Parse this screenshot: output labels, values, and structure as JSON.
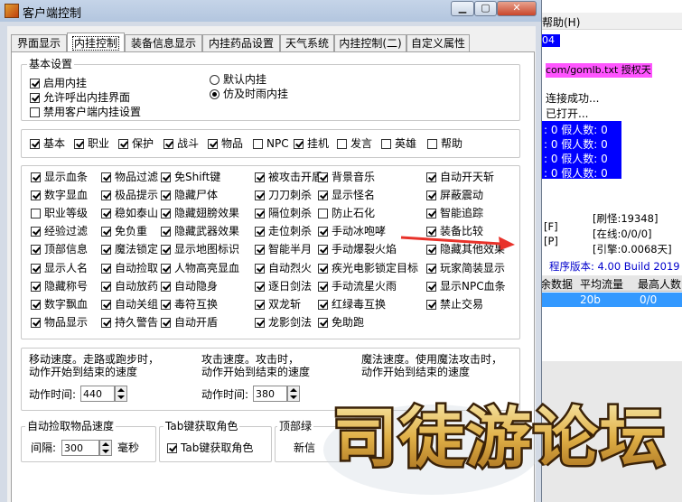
{
  "dialog": {
    "title": "客户端控制",
    "tabs": [
      {
        "label": "界面显示",
        "active": false
      },
      {
        "label": "内挂控制",
        "active": true
      },
      {
        "label": "装备信息显示",
        "active": false
      },
      {
        "label": "内挂药品设置",
        "active": false
      },
      {
        "label": "天气系统",
        "active": false
      },
      {
        "label": "内挂控制(二)",
        "active": false
      },
      {
        "label": "自定义属性",
        "active": false
      }
    ],
    "basic": {
      "title": "基本设置",
      "items": [
        {
          "label": "启用内挂",
          "checked": true
        },
        {
          "label": "允许呼出内挂界面",
          "checked": true
        },
        {
          "label": "禁用客户端内挂设置",
          "checked": false
        }
      ],
      "radios": [
        {
          "label": "默认内挂",
          "selected": false
        },
        {
          "label": "仿及时雨内挂",
          "selected": true
        }
      ]
    },
    "chat_filters": [
      {
        "label": "基本",
        "checked": true
      },
      {
        "label": "职业",
        "checked": true
      },
      {
        "label": "保护",
        "checked": true
      },
      {
        "label": "战斗",
        "checked": true
      },
      {
        "label": "物品",
        "checked": true
      },
      {
        "label": "NPC",
        "checked": false
      },
      {
        "label": "挂机",
        "checked": true
      },
      {
        "label": "发言",
        "checked": false
      },
      {
        "label": "英雄",
        "checked": false
      },
      {
        "label": "帮助",
        "checked": false
      }
    ],
    "options": [
      [
        {
          "label": "显示血条",
          "checked": true
        },
        {
          "label": "数字显血",
          "checked": true
        },
        {
          "label": "职业等级",
          "checked": false
        },
        {
          "label": "经验过滤",
          "checked": true
        },
        {
          "label": "顶部信息",
          "checked": true
        },
        {
          "label": "显示人名",
          "checked": true
        },
        {
          "label": "隐藏称号",
          "checked": true
        },
        {
          "label": "数字飘血",
          "checked": true
        },
        {
          "label": "物品显示",
          "checked": true
        }
      ],
      [
        {
          "label": "物品过滤",
          "checked": true
        },
        {
          "label": "极品提示",
          "checked": true
        },
        {
          "label": "稳如泰山",
          "checked": true
        },
        {
          "label": "免负重",
          "checked": true
        },
        {
          "label": "魔法锁定",
          "checked": true
        },
        {
          "label": "自动捡取",
          "checked": true
        },
        {
          "label": "自动放药",
          "checked": true
        },
        {
          "label": "自动关组",
          "checked": true
        },
        {
          "label": "持久警告",
          "checked": true
        }
      ],
      [
        {
          "label": "免Shift键",
          "checked": true
        },
        {
          "label": "隐藏尸体",
          "checked": true
        },
        {
          "label": "隐藏翅膀效果",
          "checked": true
        },
        {
          "label": "隐藏武器效果",
          "checked": true
        },
        {
          "label": "显示地图标识",
          "checked": true
        },
        {
          "label": "人物高亮显血",
          "checked": true
        },
        {
          "label": "自动隐身",
          "checked": true
        },
        {
          "label": "毒符互换",
          "checked": true
        },
        {
          "label": "自动开盾",
          "checked": true
        }
      ],
      [
        {
          "label": "被攻击开盾",
          "checked": true
        },
        {
          "label": "刀刀刺杀",
          "checked": true
        },
        {
          "label": "隔位刺杀",
          "checked": true
        },
        {
          "label": "走位刺杀",
          "checked": true
        },
        {
          "label": "智能半月",
          "checked": true
        },
        {
          "label": "自动烈火",
          "checked": true
        },
        {
          "label": "逐日剑法",
          "checked": true
        },
        {
          "label": "双龙斩",
          "checked": true
        },
        {
          "label": "龙影剑法",
          "checked": true
        }
      ],
      [
        {
          "label": "背景音乐",
          "checked": true
        },
        {
          "label": "显示怪名",
          "checked": true
        },
        {
          "label": "防止石化",
          "checked": false
        },
        {
          "label": "手动冰咆哮",
          "checked": true
        },
        {
          "label": "手动爆裂火焰",
          "checked": true
        },
        {
          "label": "疾光电影锁定目标",
          "checked": true
        },
        {
          "label": "手动流星火雨",
          "checked": true
        },
        {
          "label": "红绿毒互换",
          "checked": true
        },
        {
          "label": "免助跑",
          "checked": true
        }
      ],
      [
        {
          "label": "自动开天斩",
          "checked": true
        },
        {
          "label": "屏蔽震动",
          "checked": true
        },
        {
          "label": "智能追踪",
          "checked": true
        },
        {
          "label": "装备比较",
          "checked": true
        },
        {
          "label": "隐藏其他效果",
          "checked": true
        },
        {
          "label": "玩家简装显示",
          "checked": true
        },
        {
          "label": "显示NPC血条",
          "checked": true
        },
        {
          "label": "禁止交易",
          "checked": true
        }
      ]
    ],
    "speed": {
      "move_desc1": "移动速度。走路或跑步时，",
      "move_desc2": "动作开始到结束的速度",
      "move_label": "动作时间:",
      "move_value": "440",
      "attack_desc1": "攻击速度。攻击时，",
      "attack_desc2": "动作开始到结束的速度",
      "attack_label": "动作时间:",
      "attack_value": "380",
      "magic_desc1": "魔法速度。使用魔法攻击时，",
      "magic_desc2": "动作开始到结束的速度"
    },
    "pickup": {
      "title": "自动捡取物品速度",
      "label": "间隔:",
      "value": "300",
      "unit": "毫秒"
    },
    "tab_key": {
      "title": "Tab键获取角色",
      "checkbox": "Tab键获取角色",
      "checked": true
    },
    "top_frag": {
      "title": "顶部绿",
      "text": "新信"
    }
  },
  "background": {
    "menu": "帮助(H)",
    "strip": "04",
    "url": "com/gomlb.txt 授权天",
    "log1": "连接成功...",
    "log2": "已打开...",
    "fake_lines": [
      ": 0 假人数: 0",
      ": 0 假人数: 0",
      ": 0 假人数: 0",
      ": 0 假人数: 0"
    ],
    "stats": {
      "f": "[F]",
      "p": "[P]",
      "refresh": "[刷怪:19348]",
      "online": "[在线:0/0/0]",
      "engine": "[引擎:0.0068天]"
    },
    "version": "程序版本: 4.00 Build 2019",
    "table_headers": [
      "余数据",
      "平均流量",
      "最高人数"
    ],
    "table_row": [
      "20b",
      "0/0"
    ]
  },
  "watermark": {
    "text": "司徒游论坛"
  }
}
